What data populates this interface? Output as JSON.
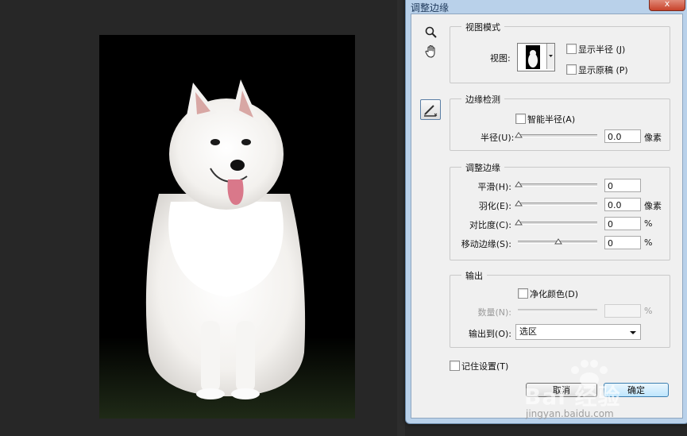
{
  "dialog": {
    "title": "调整边缘",
    "close_label": "x"
  },
  "tools": {
    "zoom": "zoom-icon",
    "hand": "hand-icon",
    "refine_radius": "refine-radius-brush-icon"
  },
  "view_mode": {
    "group_label": "视图模式",
    "view_label": "视图:",
    "show_radius": "显示半径 (J)",
    "show_original": "显示原稿 (P)",
    "show_radius_checked": false,
    "show_original_checked": false
  },
  "edge_detection": {
    "group_label": "边缘检测",
    "smart_radius": "智能半径(A)",
    "smart_radius_checked": false,
    "radius_label": "半径(U):",
    "radius_value": "0.0",
    "radius_unit": "像素",
    "radius_level": 0
  },
  "adjust_edge": {
    "group_label": "调整边缘",
    "rows": [
      {
        "label": "平滑(H):",
        "value": "0",
        "unit": "",
        "level": 0
      },
      {
        "label": "羽化(E):",
        "value": "0.0",
        "unit": "像素",
        "level": 0
      },
      {
        "label": "对比度(C):",
        "value": "0",
        "unit": "%",
        "level": 0
      },
      {
        "label": "移动边缘(S):",
        "value": "0",
        "unit": "%",
        "level": 0.5
      }
    ]
  },
  "output": {
    "group_label": "输出",
    "decontaminate": "净化颜色(D)",
    "decontaminate_checked": false,
    "amount_label": "数量(N):",
    "amount_value": "",
    "amount_unit": "%",
    "output_to_label": "输出到(O):",
    "output_to_value": "选区"
  },
  "remember": {
    "label": "记住设置(T)",
    "checked": false
  },
  "buttons": {
    "cancel": "取消",
    "ok": "确定"
  },
  "watermark": {
    "big": "Bai 经验",
    "small": "jingyan.baidu.com"
  }
}
